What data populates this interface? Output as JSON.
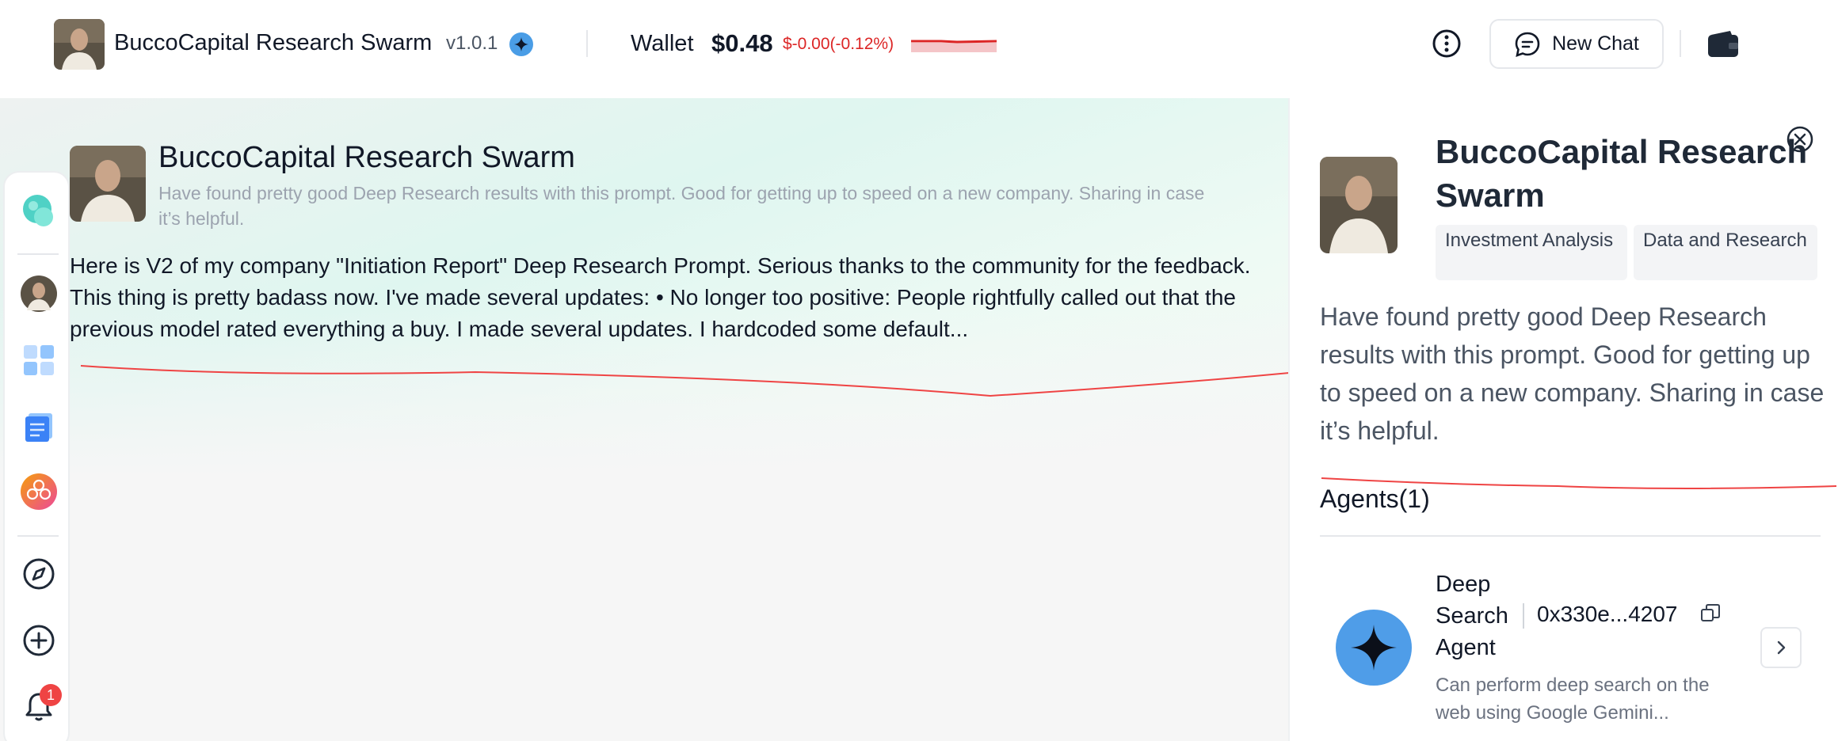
{
  "header": {
    "app_title": "BuccoCapital Research Swarm",
    "version": "v1.0.1",
    "wallet_label": "Wallet",
    "wallet_value": "$0.48",
    "wallet_change": "$-0.00(-0.12%)",
    "new_chat_label": "New Chat"
  },
  "sidebar": {
    "items": [
      {
        "name": "chat-app-icon"
      },
      {
        "name": "user-avatar"
      },
      {
        "name": "grid-apps-icon"
      },
      {
        "name": "documents-icon"
      },
      {
        "name": "flower-app-icon"
      },
      {
        "name": "compass-icon"
      },
      {
        "name": "add-circle-icon"
      },
      {
        "name": "bell-icon"
      }
    ],
    "notification_count": "1"
  },
  "main": {
    "title": "BuccoCapital Research Swarm",
    "subtitle": "Have found pretty good Deep Research results with this prompt. Good for getting up to speed on a new company. Sharing in case it’s helpful.",
    "description": "Here is V2 of my company \"Initiation Report\" Deep Research Prompt. Serious thanks to the community for the feedback. This thing is pretty badass now. I've made several updates: • No longer too positive: People rightfully called out that the previous model rated everything a buy. I made several updates. I hardcoded some default..."
  },
  "panel": {
    "title": "BuccoCapital Research Swarm",
    "tags": [
      "Investment Analysis",
      "Data and Research"
    ],
    "description": "Have found pretty good Deep Research results with this prompt. Good for getting up to speed on a new company. Sharing in case it’s helpful.",
    "agents_heading": "Agents(1)",
    "agent": {
      "name": "Deep Search Agent",
      "address": "0x330e...4207",
      "description": "Can perform deep search on the web using Google Gemini..."
    }
  },
  "colors": {
    "accent_blue": "#4f9de8",
    "negative_red": "#dc2626",
    "badge_red": "#ef4444"
  }
}
